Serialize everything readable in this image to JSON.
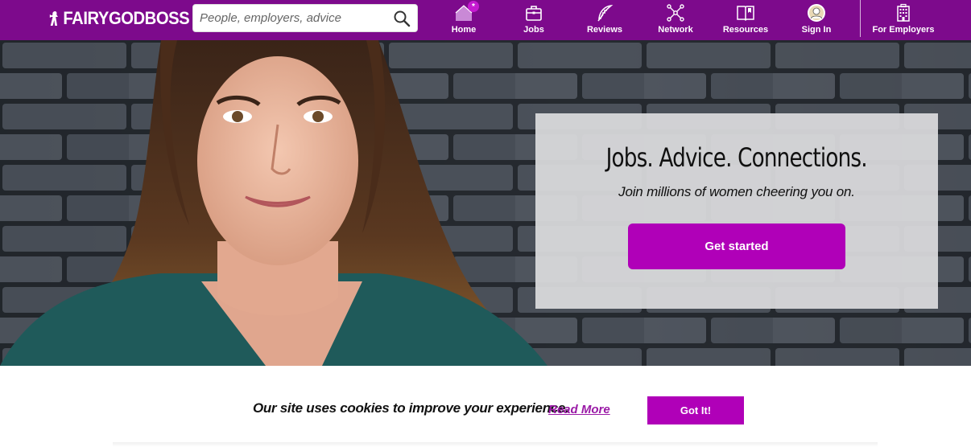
{
  "header": {
    "logo_text": "FAIRYGODBOSS",
    "search": {
      "placeholder": "People, employers, advice",
      "value": ""
    },
    "nav": [
      {
        "label": "Home",
        "icon": "home-icon",
        "badge": "*"
      },
      {
        "label": "Jobs",
        "icon": "briefcase-icon"
      },
      {
        "label": "Reviews",
        "icon": "feather-icon"
      },
      {
        "label": "Network",
        "icon": "network-icon"
      },
      {
        "label": "Resources",
        "icon": "book-icon"
      },
      {
        "label": "Sign In",
        "icon": "avatar-icon"
      },
      {
        "label": "For Employers",
        "icon": "building-icon"
      }
    ]
  },
  "hero": {
    "title": "Jobs. Advice. Connections.",
    "subtitle": "Join millions of women cheering you on.",
    "cta_label": "Get started"
  },
  "cookie_banner": {
    "message": "Our site uses cookies to improve your experience.",
    "link_label": "Read More",
    "button_label": "Got It!"
  },
  "colors": {
    "brand_purple": "#7d0a8c",
    "button_purple": "#b000b8",
    "link_purple": "#9a1aa6"
  }
}
